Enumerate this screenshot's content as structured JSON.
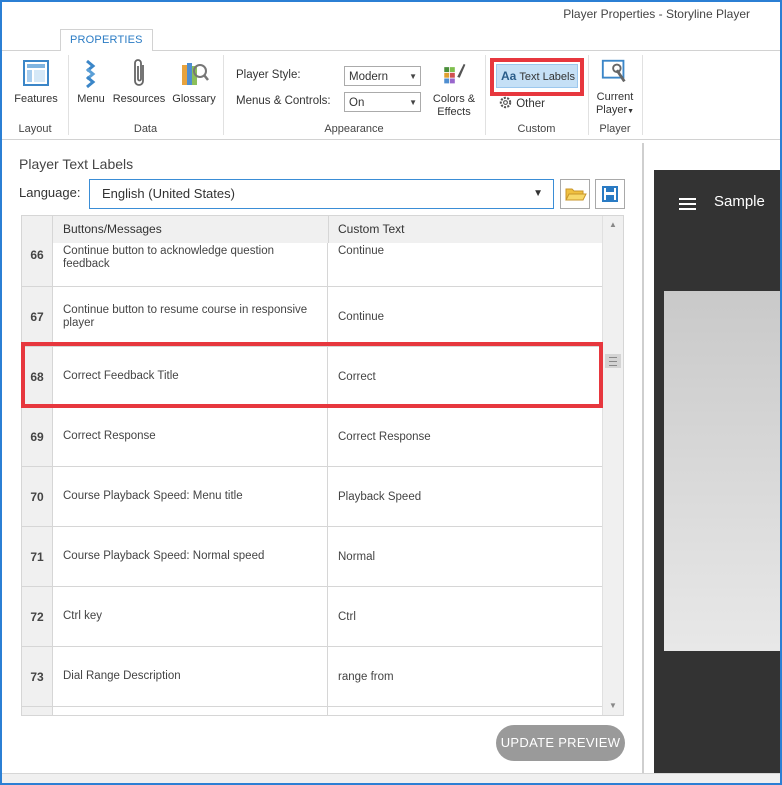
{
  "window": {
    "title": "Player Properties - Storyline Player"
  },
  "ribbon": {
    "tab": "PROPERTIES",
    "groups": {
      "layout": {
        "label": "Layout",
        "features": "Features"
      },
      "data": {
        "label": "Data",
        "menu": "Menu",
        "resources": "Resources",
        "glossary": "Glossary"
      },
      "appearance": {
        "label": "Appearance",
        "player_style_label": "Player Style:",
        "player_style_value": "Modern",
        "menus_controls_label": "Menus & Controls:",
        "menus_controls_value": "On",
        "colors_effects_line1": "Colors &",
        "colors_effects_line2": "Effects"
      },
      "custom": {
        "label": "Custom",
        "text_labels_prefix": "Aa",
        "text_labels": "Text Labels",
        "other": "Other"
      },
      "player": {
        "label": "Player",
        "current_player_line1": "Current",
        "current_player_line2": "Player"
      }
    }
  },
  "panel": {
    "title": "Player Text Labels",
    "language_label": "Language:",
    "language_value": "English (United States)"
  },
  "grid": {
    "headers": [
      "Buttons/Messages",
      "Custom Text"
    ],
    "rows": [
      {
        "num": "66",
        "message": "Continue button to acknowledge question feedback",
        "custom": "Continue"
      },
      {
        "num": "67",
        "message": "Continue button to resume course in responsive player",
        "custom": "Continue"
      },
      {
        "num": "68",
        "message": "Correct Feedback Title",
        "custom": "Correct"
      },
      {
        "num": "69",
        "message": "Correct Response",
        "custom": "Correct Response"
      },
      {
        "num": "70",
        "message": "Course Playback Speed: Menu title",
        "custom": "Playback Speed"
      },
      {
        "num": "71",
        "message": "Course Playback Speed: Normal speed",
        "custom": "Normal"
      },
      {
        "num": "72",
        "message": "Ctrl key",
        "custom": "Ctrl"
      },
      {
        "num": "73",
        "message": "Dial Range Description",
        "custom": "range from"
      }
    ]
  },
  "update_preview": "UPDATE PREVIEW",
  "preview": {
    "sample": "Sample"
  },
  "colors": {
    "highlight": "#e7373e",
    "accent": "#2a7bc4",
    "selected_btn": "#c5e0f6"
  }
}
